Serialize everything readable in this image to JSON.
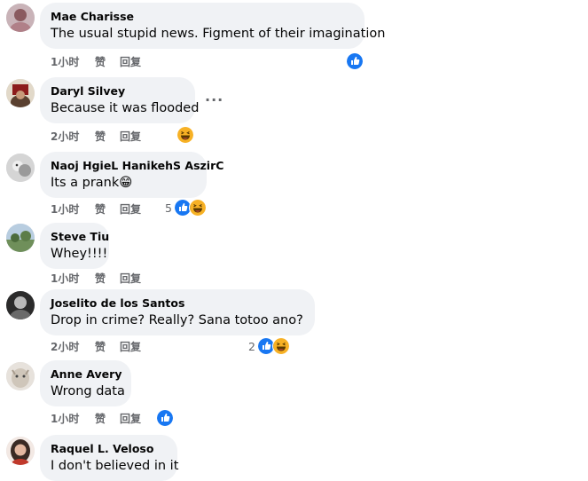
{
  "actions": {
    "like": "赞",
    "reply": "回复"
  },
  "comments": [
    {
      "name": "Mae Charisse",
      "text": "The usual stupid news. Figment of their imagination",
      "time": "1小时",
      "reaction_count": "",
      "reactions": [
        "like-icon"
      ]
    },
    {
      "name": "Daryl Silvey",
      "text": "Because it was flooded",
      "time": "2小时",
      "reaction_count": "",
      "reactions": [
        "haha-icon"
      ],
      "more": "···"
    },
    {
      "name": "Naoj HgieL HanikehS AszirC",
      "text": "Its a prank😁",
      "time": "1小时",
      "reaction_count": "5",
      "reactions": [
        "like-icon",
        "haha-icon"
      ]
    },
    {
      "name": "Steve Tiu",
      "text": "Whey!!!!",
      "time": "1小时",
      "reaction_count": "",
      "reactions": []
    },
    {
      "name": "Joselito de los Santos",
      "text": "Drop in crime? Really? Sana totoo ano?",
      "time": "2小时",
      "reaction_count": "2",
      "reactions": [
        "like-icon",
        "haha-icon"
      ]
    },
    {
      "name": "Anne Avery",
      "text": "Wrong data",
      "time": "1小时",
      "reaction_count": "",
      "reactions": [
        "like-icon"
      ]
    },
    {
      "name": "Raquel L. Veloso",
      "text": "I don't believed in it",
      "time": "",
      "reaction_count": "",
      "reactions": []
    }
  ],
  "colors": {
    "like": "#1877f2",
    "haha": "#f7b125",
    "bubble": "#f0f2f5",
    "meta": "#65676b"
  }
}
